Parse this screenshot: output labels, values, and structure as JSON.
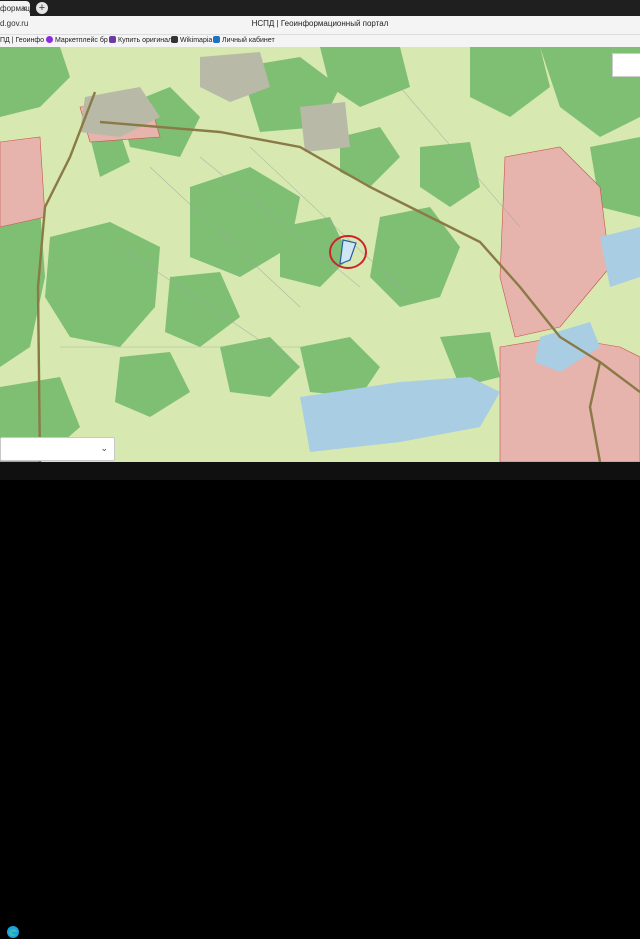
{
  "browser": {
    "tab_label": "формации",
    "tab_close": "×",
    "new_tab": "+",
    "url": "d.gov.ru",
    "page_title": "НСПД | Геоинформационный портал",
    "bookmarks": [
      {
        "label": "ПД | Геоинфо",
        "icon_color": "#3a6ea5"
      },
      {
        "label": "Маркетплейс бр",
        "icon_color": "#8a2be2"
      },
      {
        "label": "Купить оригинал",
        "icon_color": "#6b3aa3"
      },
      {
        "label": "Wikimapia",
        "icon_color": "#333333"
      },
      {
        "label": "Личный кабинет",
        "icon_color": "#1e73be"
      }
    ]
  },
  "map": {
    "colors": {
      "background": "#d7e8b1",
      "forest": "#7fbf73",
      "settlement": "#e7b3ad",
      "road": "#8a7a45",
      "water": "#a9cde3",
      "marker": "#d0222a"
    },
    "layer_select_arrow": "⌄"
  },
  "taskbar": {
    "start_icon": "edge-icon"
  }
}
